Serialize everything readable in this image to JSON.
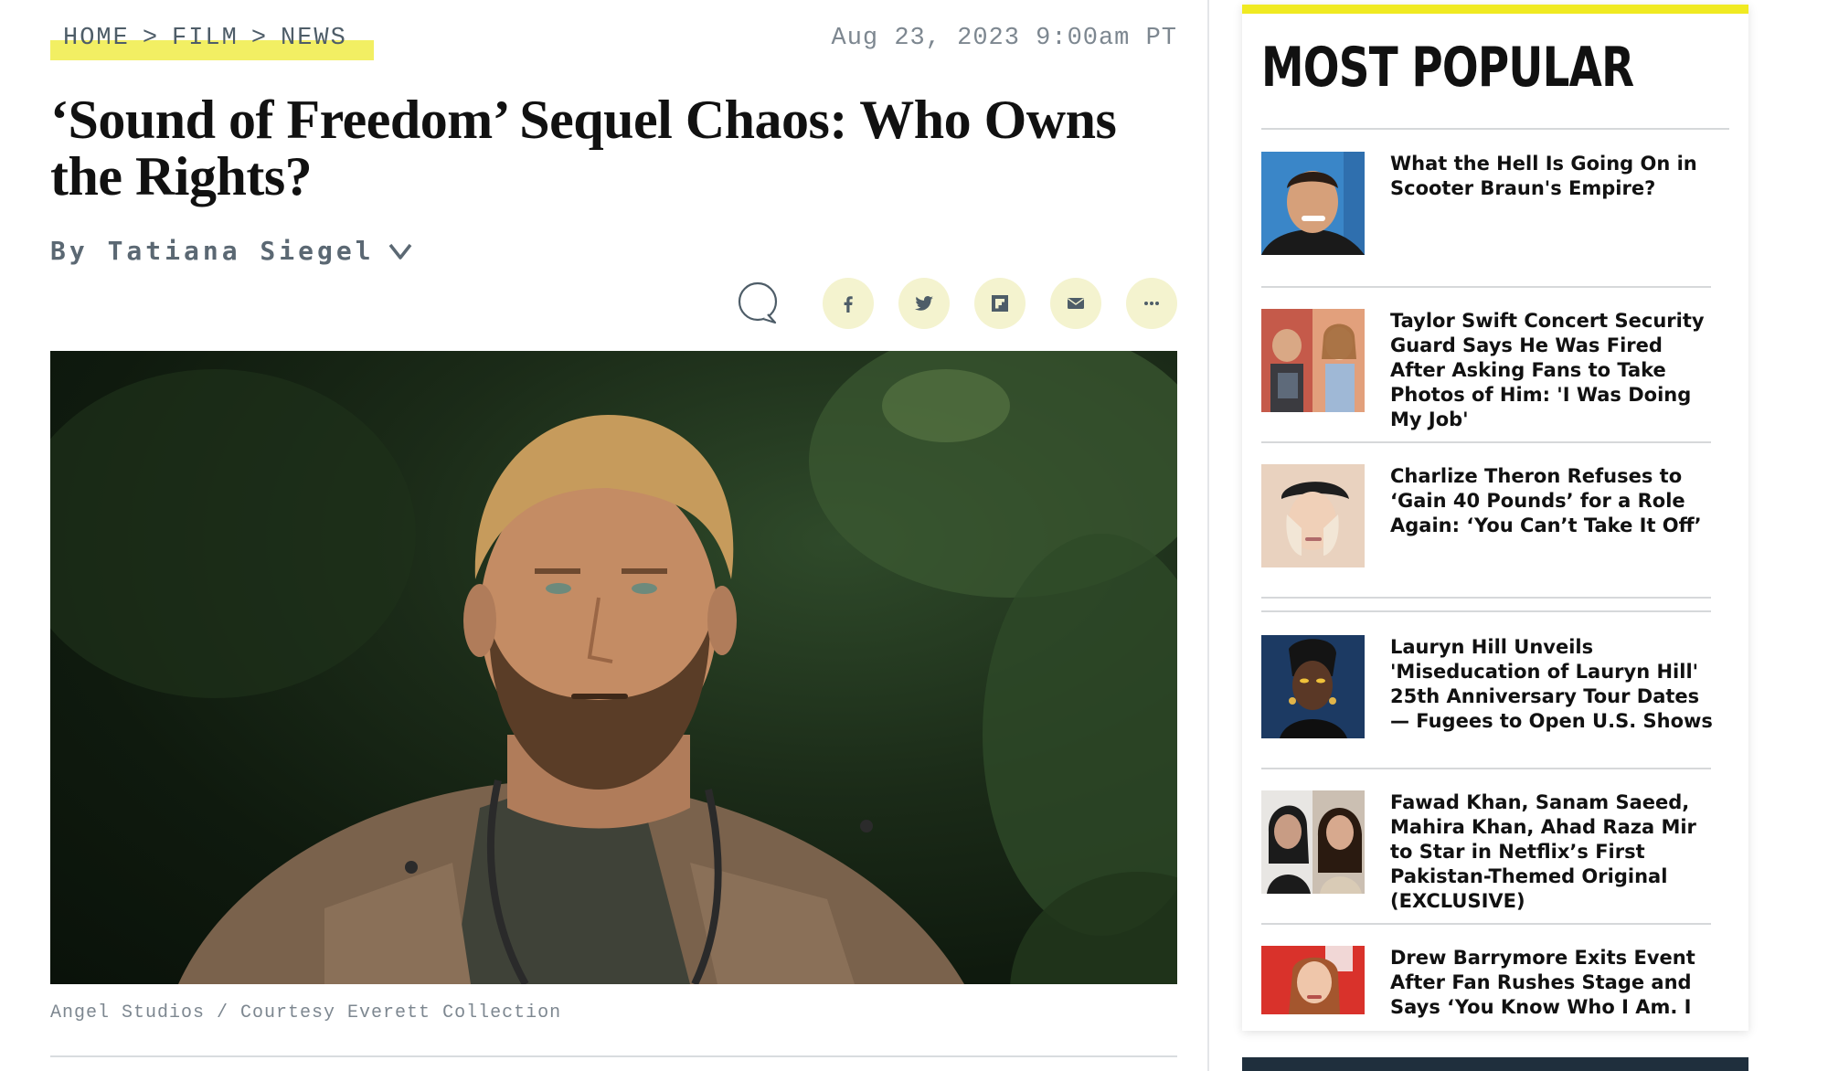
{
  "breadcrumb": {
    "items": [
      "HOME",
      "FILM",
      "NEWS"
    ],
    "separator": ">"
  },
  "dateline": "Aug 23, 2023 9:00am PT",
  "headline": "‘Sound of Freedom’ Sequel Chaos: Who Owns the Rights?",
  "byline": "By Tatiana Siegel",
  "share": {
    "icons": [
      "comment-icon",
      "facebook-icon",
      "twitter-icon",
      "flipboard-icon",
      "email-icon",
      "more-icon"
    ]
  },
  "hero": {
    "caption": "Angel Studios / Courtesy Everett Collection"
  },
  "sidebar": {
    "title": "MOST POPULAR",
    "items": [
      {
        "title": "What the Hell Is Going On in Scooter Braun's Empire?"
      },
      {
        "title": "Taylor Swift Concert Security Guard Says He Was Fired After Asking Fans to Take Photos of Him: 'I Was Doing My Job'"
      },
      {
        "title": "Charlize Theron Refuses to ‘Gain 40 Pounds’ for a Role Again: ‘You Can’t Take It Off’"
      },
      {
        "title": "Lauryn Hill Unveils 'Miseducation of Lauryn Hill' 25th Anniversary Tour Dates — Fugees to Open U.S. Shows"
      },
      {
        "title": "Fawad Khan, Sanam Saeed, Mahira Khan, Ahad Raza Mir to Star in Netflix’s First Pakistan-Themed Original (EXCLUSIVE)"
      },
      {
        "title": "Drew Barrymore Exits Event After Fan Rushes Stage and Says ‘You Know Who I Am. I Need to"
      }
    ],
    "accent_color": "#f0ea22"
  },
  "colors": {
    "highlight": "#f2ef63",
    "share_bg": "#f4f3cf",
    "share_icon": "#4e5d68",
    "meta_text": "#7d8790"
  }
}
